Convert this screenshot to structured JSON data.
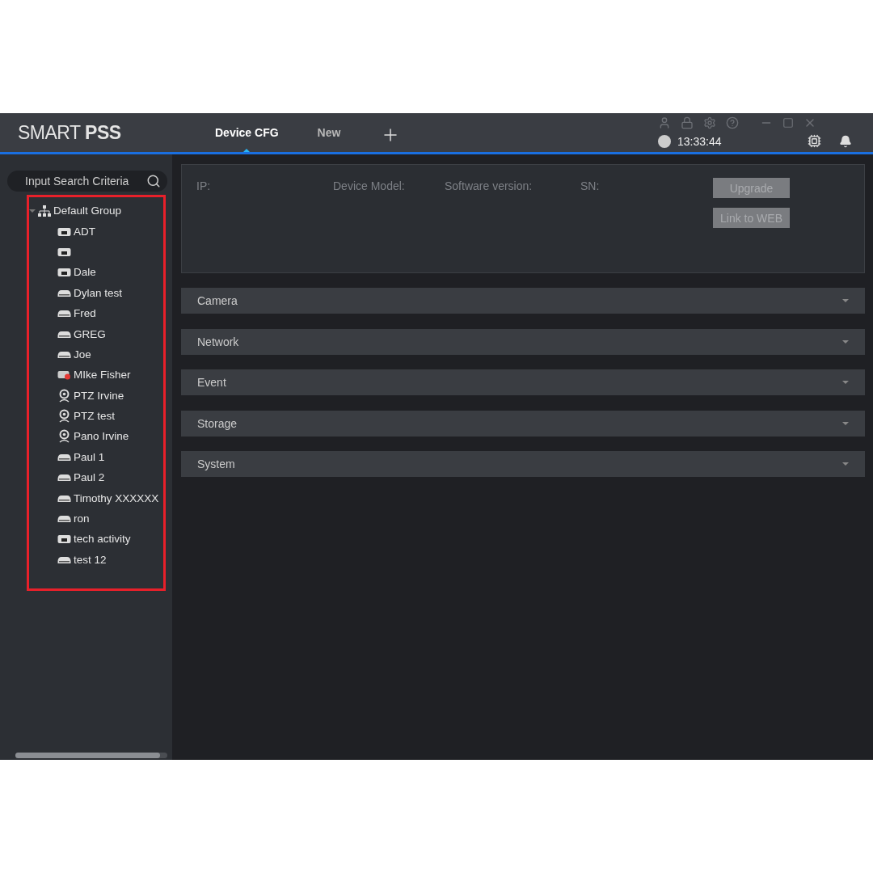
{
  "app": {
    "logo": "SMART **PSS**"
  },
  "tabs": [
    {
      "label": "Device CFG",
      "selected": true
    },
    {
      "label": "New",
      "selected": false
    }
  ],
  "header": {
    "time": "13:33:44"
  },
  "search": {
    "placeholder": "Input Search Criteria"
  },
  "tree": {
    "highlighted": true,
    "group": {
      "label": "Default Group",
      "expanded": true,
      "children": [
        {
          "name": "ADT",
          "kind": "dvr"
        },
        {
          "kind": "dvr"
        },
        {
          "name": "Dale",
          "kind": "dvr"
        },
        {
          "name": "Dylan test",
          "kind": "nvr"
        },
        {
          "name": "Fred",
          "kind": "nvr"
        },
        {
          "name": "GREG",
          "kind": "nvr"
        },
        {
          "name": "Joe",
          "kind": "nvr"
        },
        {
          "name": "MIke Fisher",
          "kind": "offline"
        },
        {
          "name": "PTZ Irvine",
          "kind": "camera"
        },
        {
          "name": "PTZ test",
          "kind": "camera"
        },
        {
          "name": "Pano Irvine",
          "kind": "camera"
        },
        {
          "name": "Paul 1",
          "kind": "nvr"
        },
        {
          "name": "Paul 2",
          "kind": "nvr"
        },
        {
          "name": "Timothy  XXXXXX",
          "kind": "nvr"
        },
        {
          "name": "ron",
          "kind": "nvr"
        },
        {
          "name": "tech activity",
          "kind": "dvr"
        },
        {
          "name": "test 12",
          "kind": "nvr"
        }
      ]
    }
  },
  "info": {
    "fields": [
      "IP:",
      "Device Model:",
      "Software version:",
      "SN:"
    ],
    "buttons": [
      "Upgrade",
      "Link to WEB"
    ]
  },
  "sections": [
    {
      "label": "Camera",
      "expanded": false
    },
    {
      "label": "Network",
      "expanded": false
    },
    {
      "label": "Event",
      "expanded": false
    },
    {
      "label": "Storage",
      "expanded": false
    },
    {
      "label": "System",
      "expanded": false
    }
  ]
}
